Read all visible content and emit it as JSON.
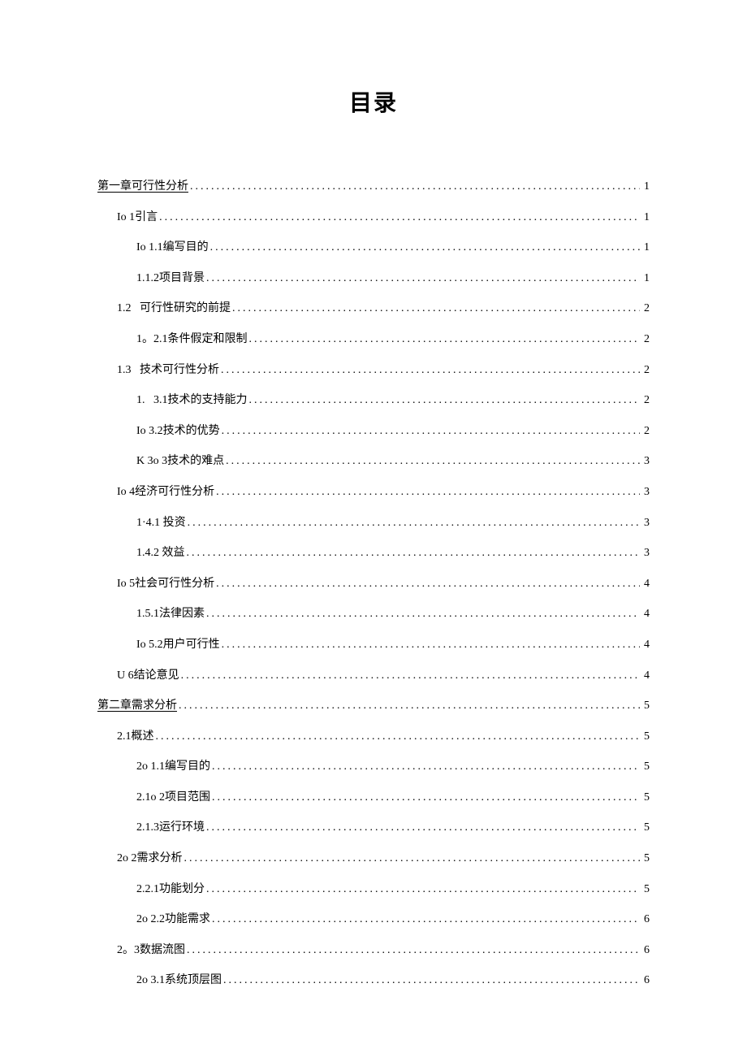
{
  "title": "目录",
  "entries": [
    {
      "level": 0,
      "label": "第一章可行性分析",
      "page": "1"
    },
    {
      "level": 1,
      "label": "Io 1引言",
      "page": "1"
    },
    {
      "level": 2,
      "label": "Io 1.1编写目的",
      "page": "1"
    },
    {
      "level": 2,
      "label": "1.1.2项目背景",
      "page": "1"
    },
    {
      "level": 1,
      "label": "1.2   可行性研究的前提",
      "page": "2"
    },
    {
      "level": 2,
      "label": "1。2.1条件假定和限制",
      "page": "2"
    },
    {
      "level": 1,
      "label": "1.3   技术可行性分析",
      "page": "2"
    },
    {
      "level": 2,
      "label": "1.   3.1技术的支持能力",
      "page": "2"
    },
    {
      "level": 2,
      "label": "Io 3.2技术的优势",
      "page": "2"
    },
    {
      "level": 2,
      "label": "K 3o 3技术的难点",
      "page": "3"
    },
    {
      "level": 1,
      "label": "Io 4经济可行性分析",
      "page": "3"
    },
    {
      "level": 2,
      "label": "1·4.1 投资",
      "page": "3"
    },
    {
      "level": 2,
      "label": "1.4.2 效益",
      "page": "3"
    },
    {
      "level": 1,
      "label": "Io 5社会可行性分析",
      "page": "4"
    },
    {
      "level": 2,
      "label": "1.5.1法律因素",
      "page": "4"
    },
    {
      "level": 2,
      "label": "Io 5.2用户可行性",
      "page": "4"
    },
    {
      "level": 1,
      "label": "U 6结论意见",
      "page": "4"
    },
    {
      "level": 0,
      "label": "第二章需求分析",
      "page": "5"
    },
    {
      "level": 1,
      "label": "2.1概述",
      "page": "5"
    },
    {
      "level": 2,
      "label": "2o 1.1编写目的",
      "page": "5"
    },
    {
      "level": 2,
      "label": "2.1o 2项目范围",
      "page": "5"
    },
    {
      "level": 2,
      "label": "2.1.3运行环境",
      "page": "5"
    },
    {
      "level": 1,
      "label": "2o 2需求分析",
      "page": "5"
    },
    {
      "level": 2,
      "label": "2.2.1功能划分",
      "page": "5"
    },
    {
      "level": 2,
      "label": "2o 2.2功能需求",
      "page": "6"
    },
    {
      "level": 1,
      "label": "2。3数据流图",
      "page": "6"
    },
    {
      "level": 2,
      "label": "2o 3.1系统顶层图",
      "page": "6"
    }
  ]
}
